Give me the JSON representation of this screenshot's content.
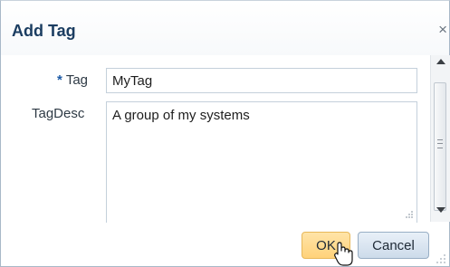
{
  "dialog": {
    "title": "Add Tag",
    "close_glyph": "×"
  },
  "form": {
    "tag": {
      "required_marker": "*",
      "label": "Tag",
      "value": "MyTag"
    },
    "tagdesc": {
      "label": "TagDesc",
      "value": "A group of my systems"
    }
  },
  "buttons": {
    "ok_label": "OK",
    "cancel_label": "Cancel"
  },
  "icons": {
    "close": "close-icon",
    "cursor": "mouse-pointer-icon",
    "scroll_up": "chevron-up-icon",
    "scroll_down": "chevron-down-icon"
  },
  "colors": {
    "title": "#1b3d61",
    "ok_button": "#ffd27a",
    "cancel_button": "#cddbea",
    "required_marker": "#1c5aa6"
  }
}
